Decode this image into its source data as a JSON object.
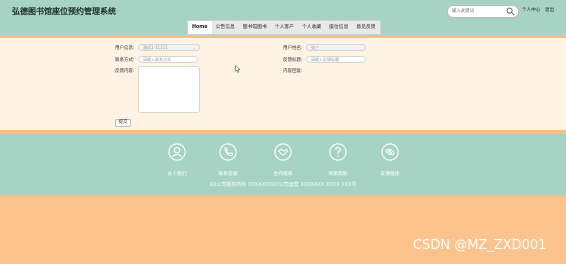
{
  "header": {
    "site_title": "弘德图书馆座位预约管理系统",
    "search_placeholder": "输入关键词",
    "personal_center": "个人中心",
    "logout": "退出"
  },
  "nav": [
    "Home",
    "公告信息",
    "图书馆图书",
    "个人客户",
    "个人收藏",
    "座位信息",
    "意见反馈"
  ],
  "form": {
    "user_account_label": "用户信息:",
    "user_account_value": "测试1-11111",
    "user_name_label": "用户姓名:",
    "user_name_value": "张三",
    "contact_label": "联系方式:",
    "contact_placeholder": "请输入联系方式",
    "feedback_title_label": "反馈标题:",
    "feedback_title_placeholder": "请输入反馈标题",
    "feedback_content_label": "反馈内容:",
    "reply_label": "内容回复:",
    "submit_label": "提交"
  },
  "footer": {
    "items": [
      {
        "label": "关于我们",
        "icon": "user-icon"
      },
      {
        "label": "联系客服",
        "icon": "phone-icon"
      },
      {
        "label": "合作招商",
        "icon": "handshake-icon"
      },
      {
        "label": "商家帮助",
        "icon": "help-icon"
      },
      {
        "label": "友情链接",
        "icon": "link-icon"
      }
    ],
    "copyright": "XX公司版权所有 XXXXXXXXX公司运营 XXXXXXX XXXX XXX号"
  },
  "watermark": "CSDN @MZ_ZXD001",
  "colors": {
    "header_bg": "#a6d3c4",
    "content_bg": "#fff3e3",
    "accent_orange": "#fcbf7e",
    "page_bg": "#fcc48c"
  }
}
